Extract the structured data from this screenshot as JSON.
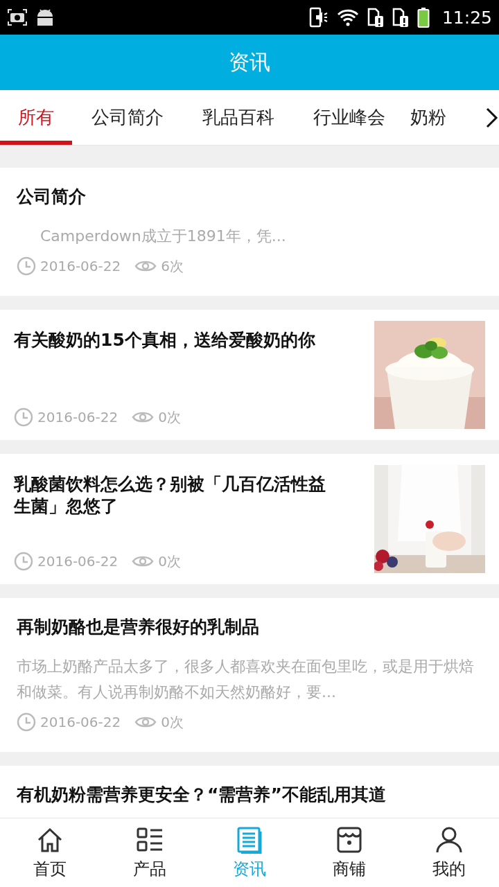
{
  "status_bar": {
    "time": "11:25"
  },
  "header": {
    "title": "资讯"
  },
  "tabs": [
    {
      "label": "所有",
      "selected": true
    },
    {
      "label": "公司简介",
      "selected": false
    },
    {
      "label": "乳品百科",
      "selected": false
    },
    {
      "label": "行业峰会",
      "selected": false
    },
    {
      "label": "奶粉",
      "selected": false
    }
  ],
  "articles": [
    {
      "kind": "text",
      "title": "公司简介",
      "summary": "Camperdown成立于1891年，凭...",
      "indent": true,
      "date": "2016-06-22",
      "views": "6次"
    },
    {
      "title": "有关酸奶的15个真相，送给爱酸奶的你",
      "date": "2016-06-22",
      "views": "0次"
    },
    {
      "title": "乳酸菌饮料怎么选？别被「几百亿活性益生菌」忽悠了",
      "date": "2016-06-22",
      "views": "0次"
    },
    {
      "kind": "text",
      "title": "再制奶酪也是营养很好的乳制品",
      "summary": "市场上奶酪产品太多了，很多人都喜欢夹在面包里吃，或是用于烘焙和做菜。有人说再制奶酪不如天然奶酪好，要...",
      "indent": false,
      "date": "2016-06-22",
      "views": "0次"
    },
    {
      "kind": "title",
      "title": "有机奶粉需营养更安全？“需营养”不能乱用其道"
    }
  ],
  "bottom_nav": [
    {
      "label": "首页",
      "selected": false
    },
    {
      "label": "产品",
      "selected": false
    },
    {
      "label": "资讯",
      "selected": true
    },
    {
      "label": "商铺",
      "selected": false
    },
    {
      "label": "我的",
      "selected": false
    }
  ]
}
